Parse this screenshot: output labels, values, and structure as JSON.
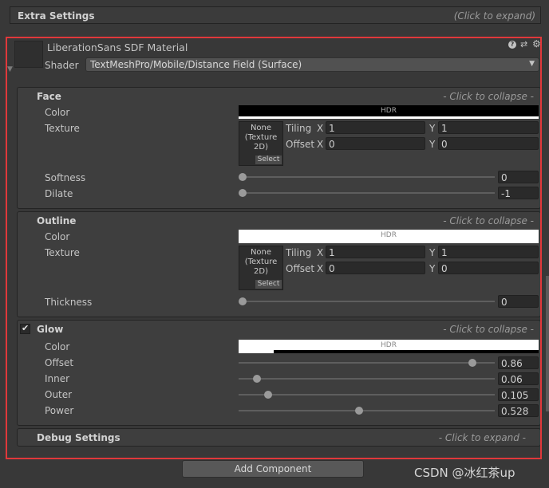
{
  "extra_settings": {
    "title": "Extra Settings",
    "hint": "(Click to expand)"
  },
  "material": {
    "name": "LiberationSans SDF Material",
    "shader_label": "Shader",
    "shader_value": "TextMeshPro/Mobile/Distance Field (Surface)"
  },
  "face": {
    "title": "Face",
    "collapse_hint": "- Click to collapse -",
    "color_label": "Color",
    "hdr": "HDR",
    "texture_label": "Texture",
    "texture": {
      "line1": "None",
      "line2": "(Texture",
      "line3": "2D)",
      "select": "Select"
    },
    "tiling_label": "Tiling",
    "offset_label": "Offset",
    "x": "X",
    "y": "Y",
    "tiling_x": "1",
    "tiling_y": "1",
    "offset_x": "0",
    "offset_y": "0",
    "softness_label": "Softness",
    "softness_value": "0",
    "softness": 0,
    "dilate_label": "Dilate",
    "dilate_value": "-1",
    "dilate": -1
  },
  "outline": {
    "title": "Outline",
    "collapse_hint": "- Click to collapse -",
    "color_label": "Color",
    "hdr": "HDR",
    "texture_label": "Texture",
    "texture": {
      "line1": "None",
      "line2": "(Texture",
      "line3": "2D)",
      "select": "Select"
    },
    "tiling_label": "Tiling",
    "offset_label": "Offset",
    "x": "X",
    "y": "Y",
    "tiling_x": "1",
    "tiling_y": "1",
    "offset_x": "0",
    "offset_y": "0",
    "thickness_label": "Thickness",
    "thickness_value": "0",
    "thickness": 0
  },
  "glow": {
    "title": "Glow",
    "enabled": true,
    "collapse_hint": "- Click to collapse -",
    "color_label": "Color",
    "hdr": "HDR",
    "offset_label": "Offset",
    "offset_value": "0.86",
    "inner_label": "Inner",
    "inner_value": "0.06",
    "outer_label": "Outer",
    "outer_value": "0.105",
    "power_label": "Power",
    "power_value": "0.528"
  },
  "debug": {
    "title": "Debug Settings",
    "hint": "- Click to expand -"
  },
  "add_component": "Add Component",
  "watermark": "CSDN @冰红茶up"
}
